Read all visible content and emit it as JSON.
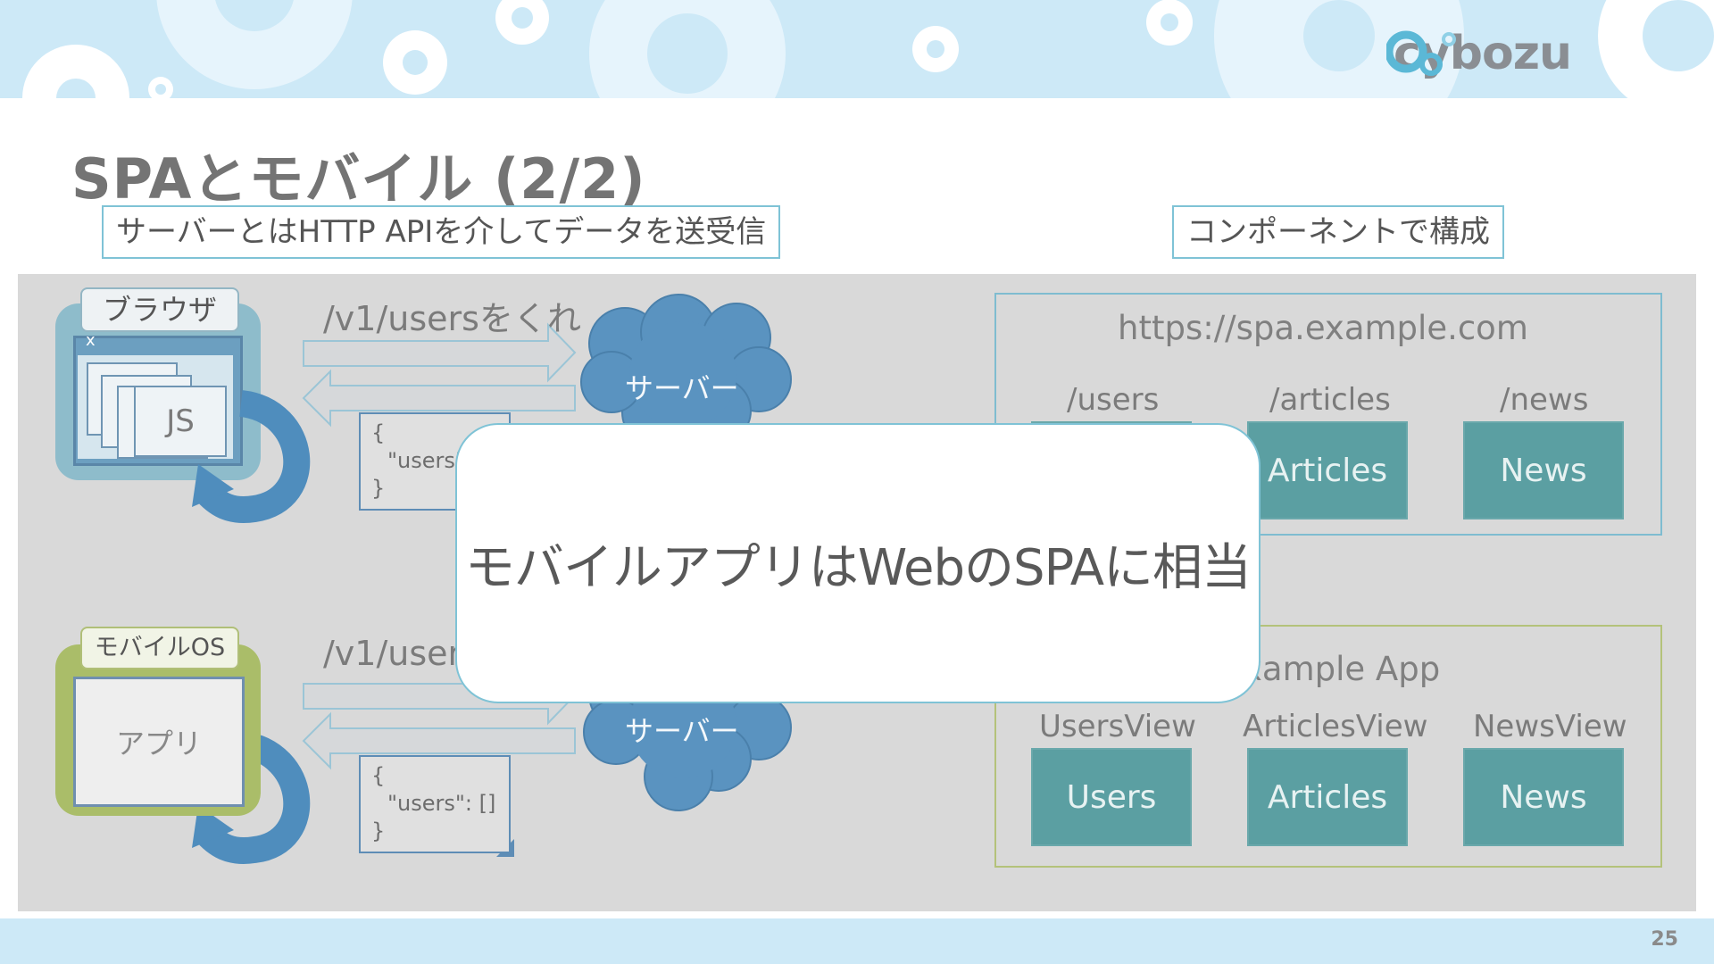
{
  "logo": {
    "text": "cybozu"
  },
  "title": "SPAとモバイル (2/2)",
  "labels": {
    "left": "サーバーとはHTTP APIを介してデータを送受信",
    "right": "コンポーネントで構成"
  },
  "browser": {
    "tab_label": "ブラウザ",
    "close": "x",
    "page_label": "JS",
    "request": "/v1/usersをくれ",
    "server": "サーバー",
    "json": {
      "open": "{",
      "body": "\"users\"",
      "close": "}"
    }
  },
  "mobile": {
    "tab_label": "モバイルOS",
    "screen_label": "アプリ",
    "request": "/v1/user",
    "server": "サーバー",
    "json": {
      "open": "{",
      "body": "\"users\": []",
      "close": "}"
    }
  },
  "web_app": {
    "url": "https://spa.example.com",
    "routes": [
      "/users",
      "/articles",
      "/news"
    ],
    "tiles": [
      "Articles",
      "News"
    ]
  },
  "mobile_app": {
    "title": "xample App",
    "views": [
      "UsersView",
      "ArticlesView",
      "NewsView"
    ],
    "tiles": [
      "Users",
      "Articles",
      "News"
    ]
  },
  "popup": {
    "text": "モバイルアプリはWebのSPAに相当"
  },
  "page_number": "25",
  "colors": {
    "band": "#cde9f7",
    "stage": "#d9d9d9",
    "tile": "#5b9fa2",
    "web_border": "#7fbcd0",
    "mobile_border": "#b4c27a",
    "cloud": "#5a93c0",
    "loop_arrow": "#4f8dbd"
  }
}
